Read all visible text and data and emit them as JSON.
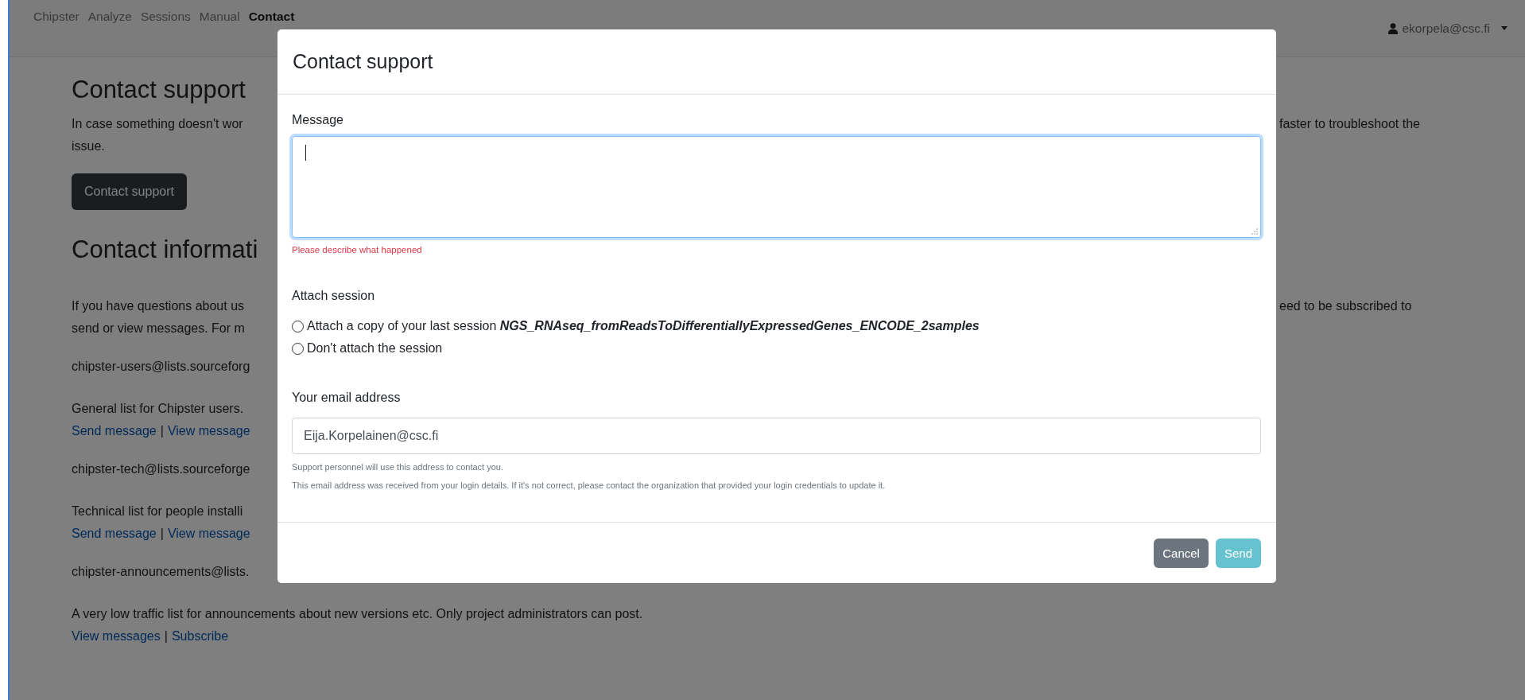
{
  "navbar": {
    "items": [
      {
        "label": "Chipster",
        "selected": false
      },
      {
        "label": "Analyze",
        "selected": false
      },
      {
        "label": "Sessions",
        "selected": false
      },
      {
        "label": "Manual",
        "selected": false
      },
      {
        "label": "Contact",
        "selected": true
      }
    ],
    "user": "ekorpela@csc.fi"
  },
  "page": [
    {
      "kind": "heading",
      "text": "Contact support"
    },
    {
      "kind": "paragraph",
      "lines": [
        {
          "text": "In case something doesn't wor",
          "right": "faster to troubleshoot the"
        },
        {
          "text": "issue."
        }
      ]
    },
    {
      "kind": "button",
      "text": "Contact support"
    },
    {
      "kind": "heading",
      "text": "Contact informati"
    },
    {
      "kind": "paragraph",
      "lines": [
        {
          "text": "If you have questions about us",
          "right": "eed to be subscribed to"
        },
        {
          "text": "send or view messages. For m"
        }
      ]
    },
    {
      "kind": "address",
      "lines": [
        {
          "text": "chipster-users@lists.sourceforg"
        }
      ]
    },
    {
      "kind": "paragraph",
      "lines": [
        {
          "text": "General list for Chipster users."
        },
        {
          "links": [
            "Send message",
            "View message"
          ],
          "separator": "|"
        }
      ]
    },
    {
      "kind": "address",
      "lines": [
        {
          "text": "chipster-tech@lists.sourceforge"
        }
      ]
    },
    {
      "kind": "paragraph",
      "lines": [
        {
          "text": "Technical list for people installi"
        },
        {
          "links": [
            "Send message",
            "View message"
          ],
          "separator": "|"
        }
      ]
    },
    {
      "kind": "address",
      "lines": [
        {
          "text": "chipster-announcements@lists."
        }
      ]
    },
    {
      "kind": "paragraph",
      "lines": [
        {
          "text": "A very low traffic list for announcements about new versions etc. Only project administrators can post."
        },
        {
          "links": [
            "View messages",
            "Subscribe"
          ],
          "separator": "|"
        }
      ]
    }
  ],
  "dialog": {
    "title": "Contact support",
    "message": {
      "label": "Message",
      "error": "Please describe what happened"
    },
    "attach": {
      "label": "Attach session",
      "options": [
        {
          "label": "Attach a copy of your last session",
          "session": "NGS_RNAseq_fromReadsToDifferentiallyExpressedGenes_ENCODE_2samples",
          "selected": false
        },
        {
          "label": "Don't attach the session",
          "selected": false
        }
      ]
    },
    "email": {
      "label": "Your email address",
      "value": "Eija.Korpelainen@csc.fi",
      "help": [
        "Support personnel will use this address to contact you.",
        "This email address was received from your login details. If it's not correct, please contact the organization that provided your login credentials to update it."
      ]
    },
    "buttons": [
      {
        "label": "Cancel",
        "kind": "secondary",
        "disabled": false
      },
      {
        "label": "Send",
        "kind": "info",
        "disabled": true
      }
    ]
  }
}
